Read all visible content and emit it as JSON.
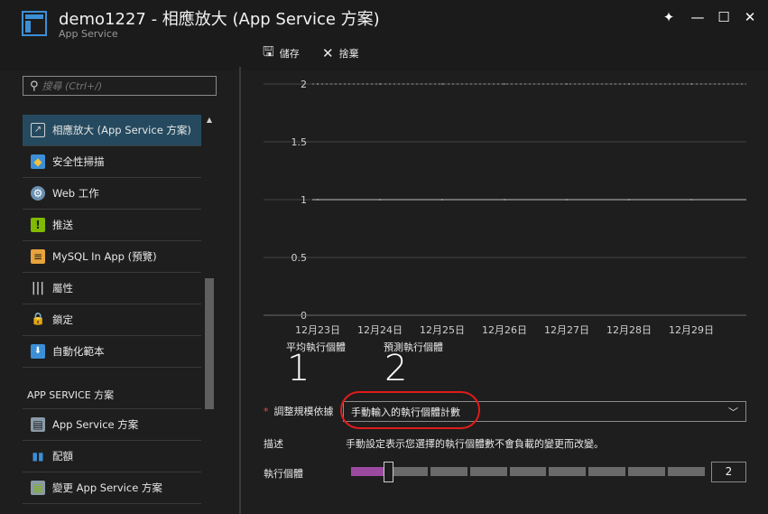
{
  "window": {
    "title": "demo1227 - 相應放大 (App Service 方案)",
    "subtitle": "App Service"
  },
  "window_controls": {
    "pin": "✦",
    "minimize": "—",
    "maximize": "☐",
    "close": "✕"
  },
  "toolbar": {
    "save_label": "儲存",
    "discard_label": "捨棄"
  },
  "search": {
    "placeholder": "搜尋 (Ctrl+/)"
  },
  "sidebar": {
    "items": [
      {
        "label": "相應放大 (App Service 方案)",
        "icon": "scale-up-icon"
      },
      {
        "label": "安全性掃描",
        "icon": "security-scan-icon"
      },
      {
        "label": "Web 工作",
        "icon": "webjobs-icon"
      },
      {
        "label": "推送",
        "icon": "push-icon"
      },
      {
        "label": "MySQL In App (預覽)",
        "icon": "mysql-icon"
      },
      {
        "label": "屬性",
        "icon": "properties-icon"
      },
      {
        "label": "鎖定",
        "icon": "lock-icon"
      },
      {
        "label": "自動化範本",
        "icon": "automation-script-icon"
      }
    ],
    "section_header": "APP SERVICE 方案",
    "section_items": [
      {
        "label": "App Service 方案",
        "icon": "app-service-plan-icon"
      },
      {
        "label": "配額",
        "icon": "quotas-icon"
      },
      {
        "label": "變更 App Service 方案",
        "icon": "change-plan-icon"
      }
    ]
  },
  "chart_data": {
    "type": "line",
    "categories": [
      "12月23日",
      "12月24日",
      "12月25日",
      "12月26日",
      "12月27日",
      "12月28日",
      "12月29日"
    ],
    "ylim": [
      0,
      2
    ],
    "yticks": [
      "0",
      "0.5",
      "1",
      "1.5",
      "2"
    ],
    "series": [
      {
        "name": "平均執行個體",
        "values": [
          1,
          1,
          1,
          1,
          1,
          1,
          1
        ]
      },
      {
        "name": "預測執行個體",
        "values": [
          2,
          2,
          2,
          2,
          2,
          2,
          2
        ]
      }
    ]
  },
  "instances": {
    "average_label": "平均執行個體",
    "average_value": "1",
    "predicted_label": "預測執行個體",
    "predicted_value": "2"
  },
  "scale_by": {
    "label": "調整規模依據",
    "value": "手動輸入的執行個體計數"
  },
  "description": {
    "label": "描述",
    "text": "手動設定表示您選擇的執行個體數不會負載的變更而改變。"
  },
  "instance_count": {
    "label": "執行個體",
    "value": "2",
    "fill_fraction": 0.1
  },
  "colors": {
    "accent_active": "#254a5f",
    "slider_fill": "#9b4a9f",
    "annotation": "#e01b1b"
  }
}
